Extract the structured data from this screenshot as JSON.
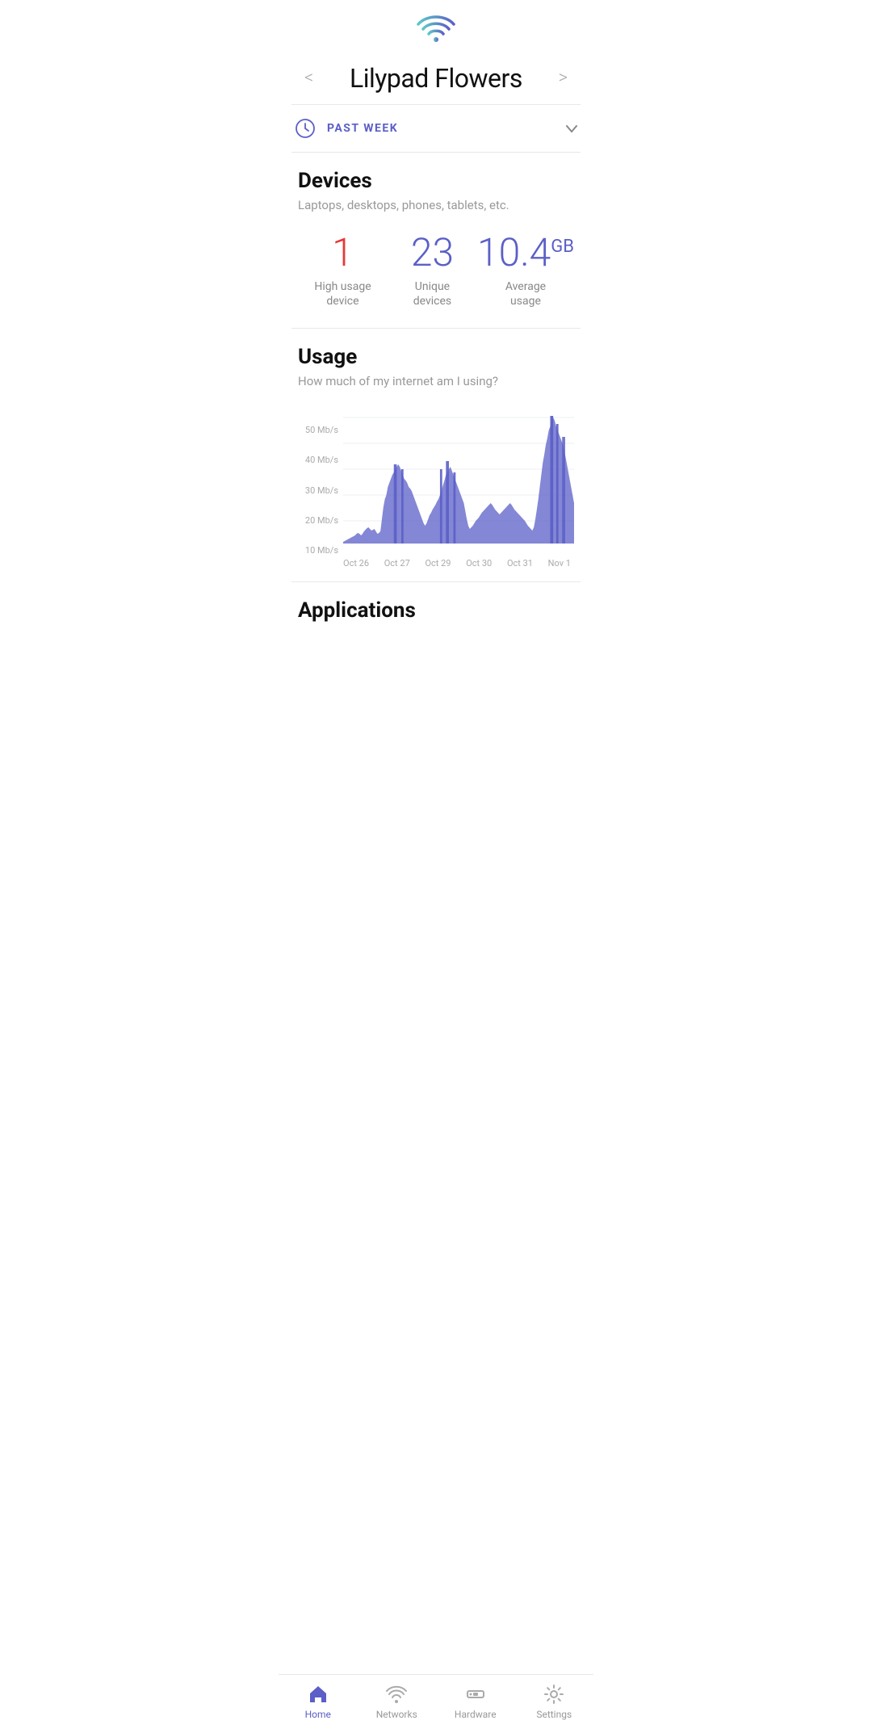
{
  "header": {
    "title": "Lilypad Flowers",
    "prev_arrow": "<",
    "next_arrow": ">"
  },
  "time_period": {
    "label": "PAST WEEK",
    "dropdown_aria": "Change time period"
  },
  "devices": {
    "section_title": "Devices",
    "section_subtitle": "Laptops, desktops, phones, tablets, etc.",
    "stats": [
      {
        "value": "1",
        "label": "High usage\ndevice",
        "color": "red"
      },
      {
        "value": "23",
        "label": "Unique\ndevices",
        "color": "purple"
      },
      {
        "value": "10.4",
        "unit": "GB",
        "label": "Average\nusage",
        "color": "purple"
      }
    ]
  },
  "usage": {
    "section_title": "Usage",
    "section_subtitle": "How much of my internet am I using?",
    "y_labels": [
      "50 Mb/s",
      "40 Mb/s",
      "30 Mb/s",
      "20 Mb/s",
      "10 Mb/s"
    ],
    "x_labels": [
      "Oct 26",
      "Oct 27",
      "Oct 29",
      "Oct 30",
      "Oct 31",
      "Nov 1"
    ]
  },
  "applications": {
    "section_title": "Applications"
  },
  "bottom_nav": [
    {
      "id": "home",
      "label": "Home",
      "active": true
    },
    {
      "id": "networks",
      "label": "Networks",
      "active": false
    },
    {
      "id": "hardware",
      "label": "Hardware",
      "active": false
    },
    {
      "id": "settings",
      "label": "Settings",
      "active": false
    }
  ]
}
